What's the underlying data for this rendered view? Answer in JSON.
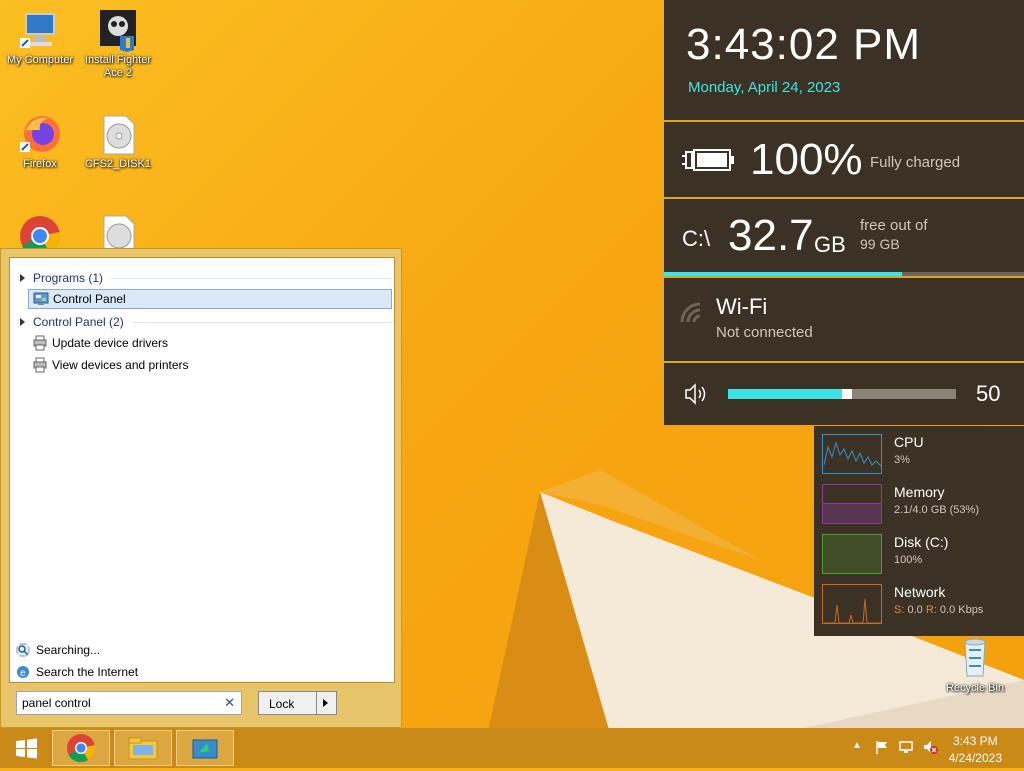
{
  "desktop": {
    "icons": [
      {
        "label": "My Computer"
      },
      {
        "label": "Install Fighter Ace 2"
      },
      {
        "label": "Firefox"
      },
      {
        "label": "CFS2_DISK1"
      },
      {
        "label": "Recycle Bin"
      }
    ]
  },
  "start_menu": {
    "groups": [
      {
        "label": "Programs (1)",
        "items": [
          {
            "label": "Control Panel",
            "selected": true
          }
        ]
      },
      {
        "label": "Control Panel (2)",
        "items": [
          {
            "label": "Update device drivers"
          },
          {
            "label": "View devices and printers"
          }
        ]
      }
    ],
    "searching": "Searching...",
    "search_internet": "Search the Internet",
    "search_value": "panel control",
    "lock_label": "Lock"
  },
  "clock_widget": {
    "time": "3:43:02 PM",
    "date": "Monday, April 24, 2023",
    "accent": "#3ee3e6"
  },
  "battery": {
    "percent": "100%",
    "status": "Fully charged"
  },
  "disk": {
    "drive": "C:\\",
    "free": "32.7",
    "unit": "GB",
    "caption1": "free out of",
    "caption2": "99 GB",
    "used_fraction": 0.66
  },
  "wifi": {
    "title": "Wi-Fi",
    "status": "Not connected"
  },
  "volume": {
    "value": "50",
    "level": 0.5
  },
  "perf": {
    "cpu": {
      "label": "CPU",
      "value": "3%"
    },
    "memory": {
      "label": "Memory",
      "value": "2.1/4.0 GB (53%)"
    },
    "disk": {
      "label": "Disk (C:)",
      "value": "100%"
    },
    "network": {
      "label": "Network",
      "s_label": "S:",
      "s_value": "0.0",
      "r_label": "R:",
      "r_value": "0.0 Kbps"
    }
  },
  "taskbar": {
    "time": "3:43 PM",
    "date": "4/24/2023"
  }
}
